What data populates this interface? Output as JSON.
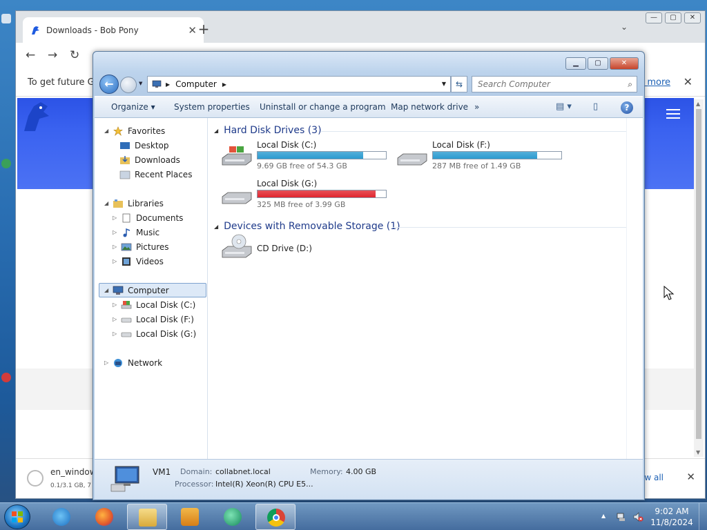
{
  "chrome": {
    "tab_title": "Downloads - Bob Pony",
    "tab_close": "✕",
    "new_tab": "+",
    "tabs_menu": "⌄",
    "window_controls": [
      "—",
      "▢",
      "✕"
    ],
    "nav": {
      "back": "←",
      "forward": "→",
      "reload": "↻"
    },
    "infobar_text": "To get future Go",
    "infobar_link": "n more",
    "infobar_close": "✕",
    "download": {
      "filename": "en_window",
      "status": "0.1/3.1 GB, 7",
      "show_all": "ow all",
      "close": "✕"
    }
  },
  "explorer": {
    "window_controls": [
      "▁",
      "▢",
      "✕"
    ],
    "back": "←",
    "address": {
      "segment": "Computer",
      "drop": "▼"
    },
    "refresh_icon": "⇆",
    "search": {
      "placeholder": "Search Computer",
      "icon": "magnifier-icon"
    },
    "commands": {
      "organize": "Organize ▾",
      "system_properties": "System properties",
      "uninstall": "Uninstall or change a program",
      "map_drive": "Map network drive",
      "more": "»",
      "views": "▤ ▾",
      "preview": "▯",
      "help": "?"
    },
    "nav_pane": {
      "favorites": "Favorites",
      "desktop": "Desktop",
      "downloads": "Downloads",
      "recent_places": "Recent Places",
      "libraries": "Libraries",
      "documents": "Documents",
      "music": "Music",
      "pictures": "Pictures",
      "videos": "Videos",
      "computer": "Computer",
      "disk_c": "Local Disk (C:)",
      "disk_f": "Local Disk (F:)",
      "disk_g": "Local Disk (G:)",
      "network": "Network"
    },
    "groups": {
      "hdd": "Hard Disk Drives (3)",
      "removable": "Devices with Removable Storage (1)"
    },
    "drives": [
      {
        "name": "Local Disk (C:)",
        "free": "9.69 GB free of 54.3 GB",
        "used_fraction": 0.82,
        "color": "#2b9bd0"
      },
      {
        "name": "Local Disk (F:)",
        "free": "287 MB free of 1.49 GB",
        "used_fraction": 0.81,
        "color": "#2b9bd0"
      },
      {
        "name": "Local Disk (G:)",
        "free": "325 MB free of 3.99 GB",
        "used_fraction": 0.92,
        "color": "#e0262f"
      }
    ],
    "cd_drive": "CD Drive (D:)",
    "details": {
      "name": "VM1",
      "domain_label": "Domain:",
      "domain_value": "collabnet.local",
      "memory_label": "Memory:",
      "memory_value": "4.00 GB",
      "processor_label": "Processor:",
      "processor_value": "Intel(R) Xeon(R) CPU E5..."
    }
  },
  "taskbar": {
    "apps": [
      "windows-explorer",
      "internet-explorer",
      "firefox",
      "explorer-folder",
      "media-player",
      "app-green",
      "chrome"
    ],
    "time": "9:02 AM",
    "date": "11/8/2024"
  },
  "colors": {
    "accent": "#2b9bd0",
    "warning": "#e0262f",
    "site_header": "#3a62f0"
  }
}
